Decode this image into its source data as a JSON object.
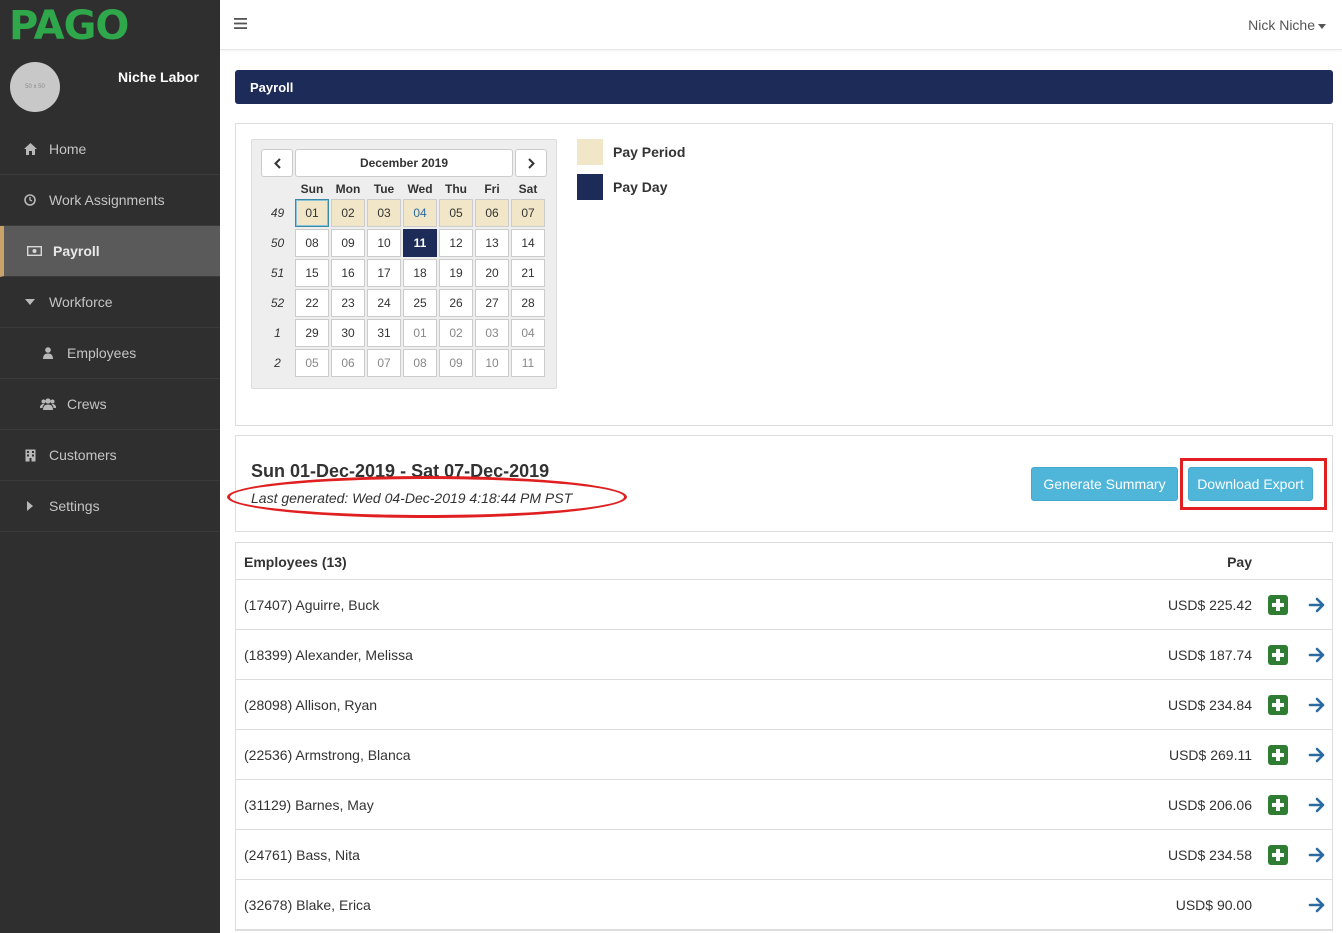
{
  "brand": {
    "logo": "PAGO",
    "company": "Niche Labor",
    "avatar_text": "50 x 50"
  },
  "topbar": {
    "user": "Nick Niche"
  },
  "nav": [
    {
      "label": "Home",
      "icon": "home-icon"
    },
    {
      "label": "Work Assignments",
      "icon": "clock-icon"
    },
    {
      "label": "Payroll",
      "icon": "money-icon",
      "active": true
    },
    {
      "label": "Workforce",
      "icon": "caret-down-icon"
    },
    {
      "label": "Employees",
      "icon": "user-icon",
      "sub": true
    },
    {
      "label": "Crews",
      "icon": "users-icon",
      "sub": true
    },
    {
      "label": "Customers",
      "icon": "building-icon"
    },
    {
      "label": "Settings",
      "icon": "caret-right-icon"
    }
  ],
  "page": {
    "title": "Payroll"
  },
  "calendar": {
    "title": "December 2019",
    "days_of_week": [
      "Sun",
      "Mon",
      "Tue",
      "Wed",
      "Thu",
      "Fri",
      "Sat"
    ],
    "weeks": [
      {
        "week": "49",
        "days": [
          "01",
          "02",
          "03",
          "04",
          "05",
          "06",
          "07"
        ]
      },
      {
        "week": "50",
        "days": [
          "08",
          "09",
          "10",
          "11",
          "12",
          "13",
          "14"
        ]
      },
      {
        "week": "51",
        "days": [
          "15",
          "16",
          "17",
          "18",
          "19",
          "20",
          "21"
        ]
      },
      {
        "week": "52",
        "days": [
          "22",
          "23",
          "24",
          "25",
          "26",
          "27",
          "28"
        ]
      },
      {
        "week": "1",
        "days": [
          "29",
          "30",
          "31",
          "01",
          "02",
          "03",
          "04"
        ]
      },
      {
        "week": "2",
        "days": [
          "05",
          "06",
          "07",
          "08",
          "09",
          "10",
          "11"
        ]
      }
    ]
  },
  "legend": [
    {
      "label": "Pay Period",
      "color": "#f1e7c8"
    },
    {
      "label": "Pay Day",
      "color": "#1c2b58"
    }
  ],
  "period": {
    "title": "Sun 01-Dec-2019 - Sat 07-Dec-2019",
    "last_generated": "Last generated: Wed 04-Dec-2019 4:18:44 PM PST",
    "generate_label": "Generate Summary",
    "export_label": "Download Export"
  },
  "employees": {
    "header": "Employees (13)",
    "pay_header": "Pay",
    "rows": [
      {
        "name": "(17407) Aguirre, Buck",
        "pay": "USD$ 225.42",
        "plus": true
      },
      {
        "name": "(18399) Alexander, Melissa",
        "pay": "USD$ 187.74",
        "plus": true
      },
      {
        "name": "(28098) Allison, Ryan",
        "pay": "USD$ 234.84",
        "plus": true
      },
      {
        "name": "(22536) Armstrong, Blanca",
        "pay": "USD$ 269.11",
        "plus": true
      },
      {
        "name": "(31129) Barnes, May",
        "pay": "USD$ 206.06",
        "plus": true
      },
      {
        "name": "(24761) Bass, Nita",
        "pay": "USD$ 234.58",
        "plus": true
      },
      {
        "name": "(32678) Blake, Erica",
        "pay": "USD$ 90.00",
        "plus": false
      }
    ]
  }
}
